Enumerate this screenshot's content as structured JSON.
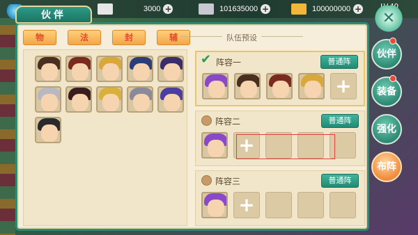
{
  "window": {
    "title": "伙伴"
  },
  "resources": [
    {
      "icon": "scroll-icon",
      "value": "3000",
      "color": "#e6e6e6"
    },
    {
      "icon": "silver-ingot-icon",
      "value": "101635000",
      "color": "#c8c8d0"
    },
    {
      "icon": "gold-bar-icon",
      "value": "100000000",
      "color": "#f2b63a"
    }
  ],
  "level_text": "LV.40",
  "filter_tabs": [
    {
      "label": "物"
    },
    {
      "label": "法"
    },
    {
      "label": "封"
    },
    {
      "label": "辅"
    }
  ],
  "roster": [
    {
      "name": "hero-1",
      "hair": "#4a2e1e"
    },
    {
      "name": "hero-2",
      "hair": "#7a2a1e"
    },
    {
      "name": "hero-3",
      "hair": "#d8a83a"
    },
    {
      "name": "hero-4",
      "hair": "#2a3e7a"
    },
    {
      "name": "hero-5",
      "hair": "#3a2e6a"
    },
    {
      "name": "hero-6",
      "hair": "#b8b8c0"
    },
    {
      "name": "hero-7",
      "hair": "#3a1e1e"
    },
    {
      "name": "hero-8",
      "hair": "#d8b03a"
    },
    {
      "name": "hero-9",
      "hair": "#8a8a9a"
    },
    {
      "name": "hero-10",
      "hair": "#4a3ea0"
    },
    {
      "name": "hero-11",
      "hair": "#2a2a2a"
    }
  ],
  "team_presets": {
    "title": "队伍预设",
    "lineups": [
      {
        "name": "阵容一",
        "mode": "普通阵",
        "active": true,
        "slots": [
          "hero",
          "hero",
          "hero",
          "hero",
          "add"
        ]
      },
      {
        "name": "阵容二",
        "mode": "普通阵",
        "active": false,
        "slots": [
          "hero",
          "add",
          "empty",
          "empty",
          "empty"
        ]
      },
      {
        "name": "阵容三",
        "mode": "普通阵",
        "active": false,
        "slots": [
          "hero",
          "add",
          "empty",
          "empty",
          "empty"
        ]
      }
    ]
  },
  "side_tabs": [
    {
      "label": "伙伴",
      "badge": true,
      "selected": false
    },
    {
      "label": "装备",
      "badge": true,
      "selected": false
    },
    {
      "label": "强化",
      "badge": false,
      "selected": false
    },
    {
      "label": "布阵",
      "badge": false,
      "selected": true
    }
  ]
}
